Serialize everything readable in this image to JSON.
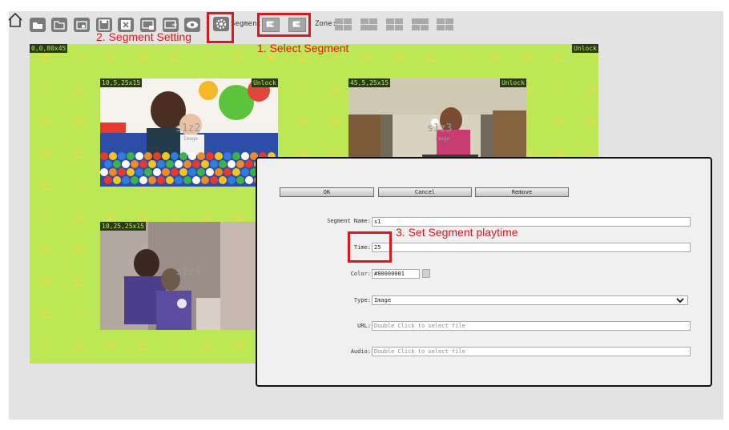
{
  "toolbar": {
    "home_icon": "home-icon",
    "buttons": [
      "open-folder-icon",
      "folder-icon",
      "new-window-icon",
      "save-icon",
      "close-icon",
      "preview-icon",
      "export-icon",
      "view-icon",
      "gear-icon"
    ],
    "segment_label": "Segment:",
    "zone_label": "Zone:"
  },
  "annotations": {
    "step1": "1. Select Segment",
    "step2": "2. Segment Setting",
    "step3": "3. Set Segment playtime"
  },
  "canvas": {
    "background_color": "#bce856",
    "info": "0,0,80x45",
    "lock_state": "Unlock",
    "zones": [
      {
        "info": "10,5,25x15",
        "lock": "Unlock",
        "name": "s1z2",
        "sub": "Image"
      },
      {
        "info": "45,5,25x15",
        "lock": "Unlock",
        "name": "s1z3",
        "sub": "Image"
      },
      {
        "info": "10,25,25x15",
        "lock": "",
        "name": "s1z4",
        "sub": ""
      }
    ]
  },
  "dialog": {
    "buttons": {
      "ok": "OK",
      "cancel": "Cancel",
      "remove": "Remove"
    },
    "fields": {
      "segment_name": {
        "label": "Segment Name:",
        "value": "s1"
      },
      "time": {
        "label": "Time:",
        "value": "25"
      },
      "color": {
        "label": "Color:",
        "value": "#80000001"
      },
      "type": {
        "label": "Type:",
        "value": "Image"
      },
      "url": {
        "label": "URL:",
        "placeholder": "Double Click to select file"
      },
      "audio": {
        "label": "Audio:",
        "placeholder": "Double Click to select file"
      }
    }
  }
}
